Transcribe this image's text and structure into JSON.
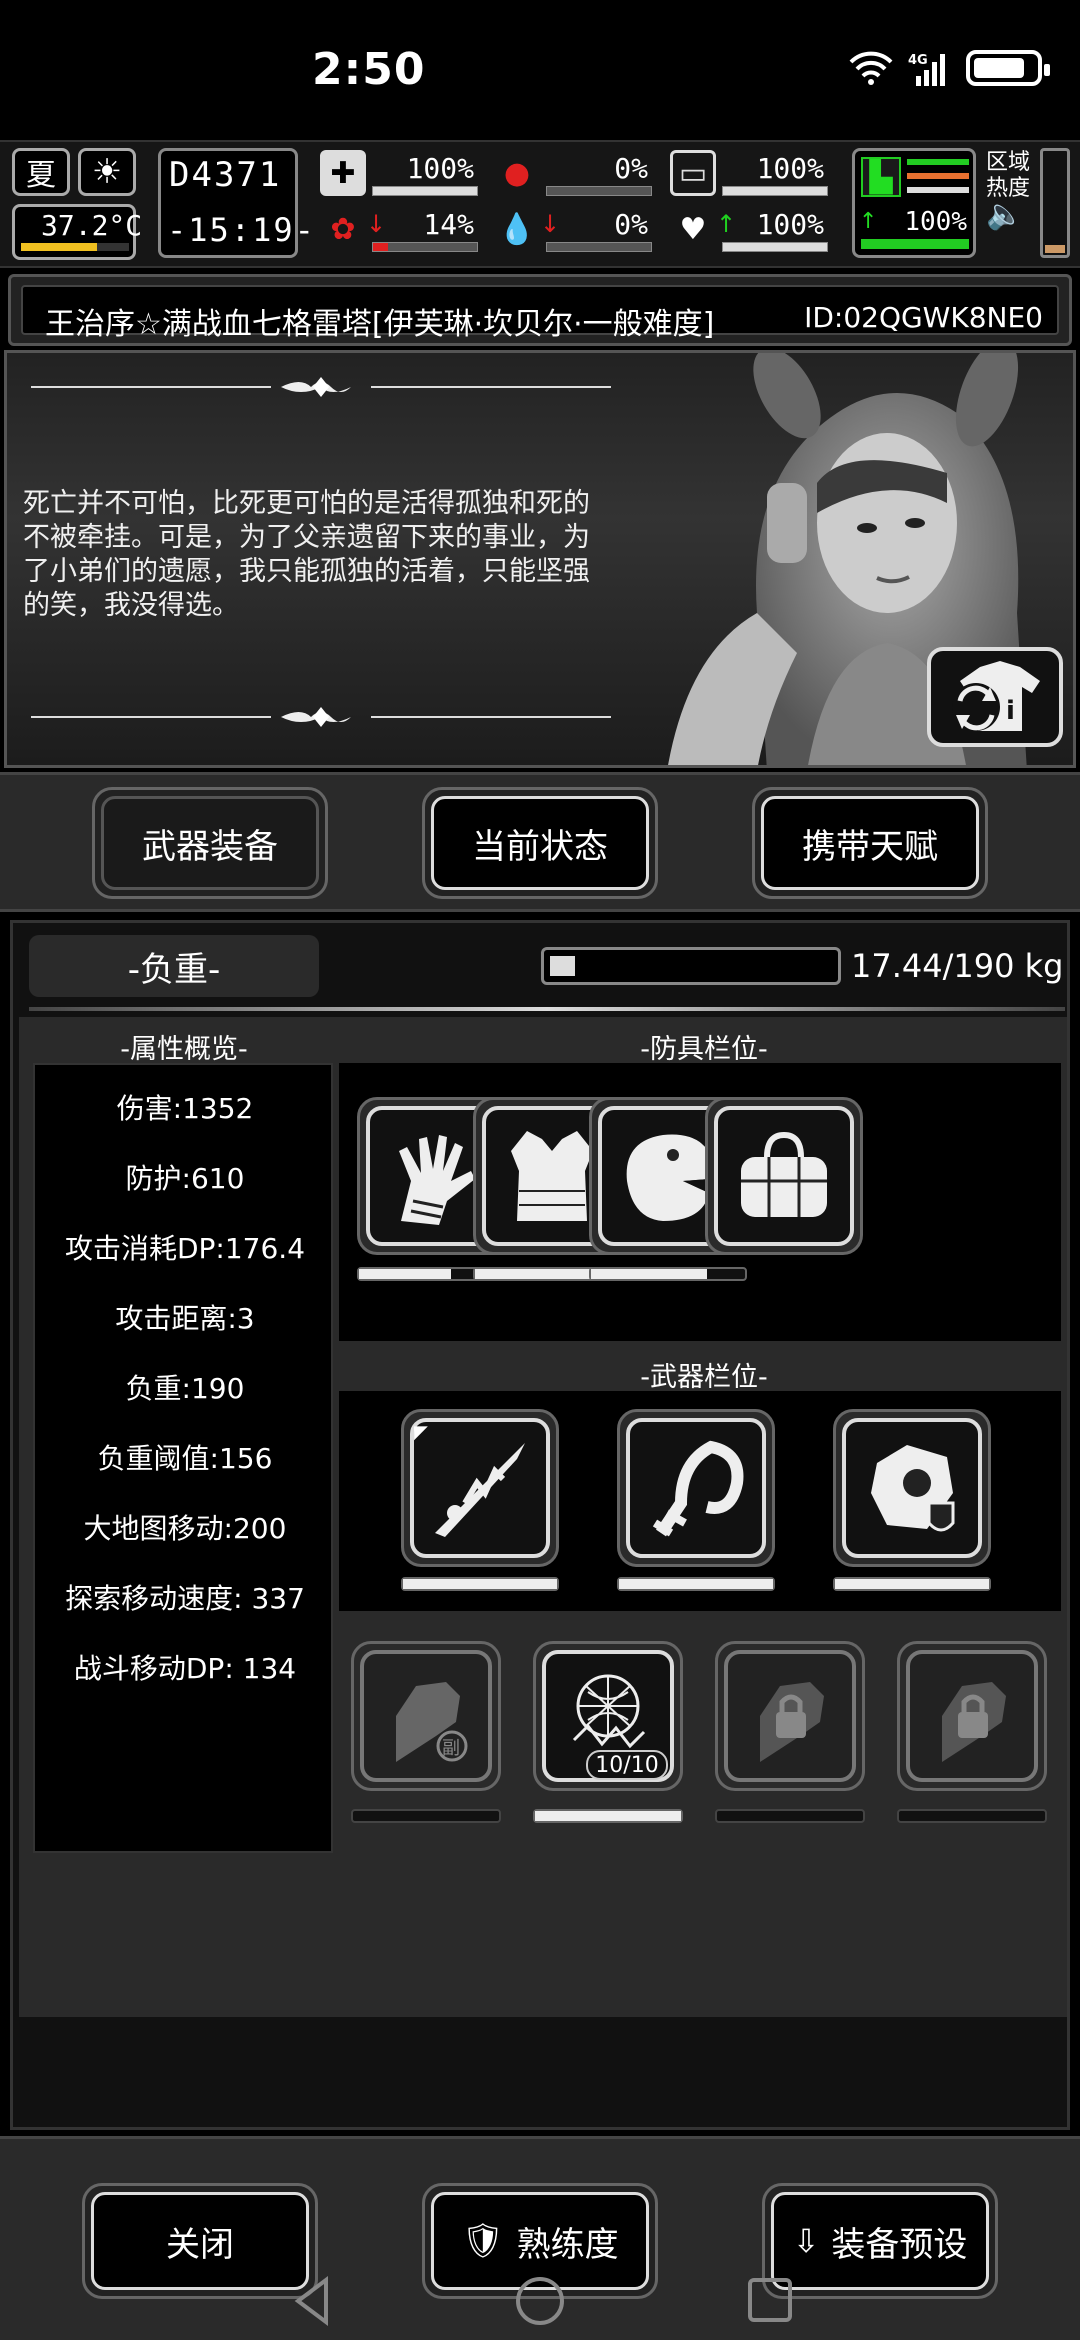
{
  "status_bar": {
    "time": "2:50",
    "network": "4G"
  },
  "hud": {
    "season": "夏",
    "temperature": "37.2°C",
    "day": "4371",
    "time": "-15:19-",
    "stats": [
      {
        "icon": "medkit-icon",
        "value": "100%",
        "level": 1.0
      },
      {
        "icon": "stomach-icon",
        "value": "0%",
        "level": 0.0
      },
      {
        "icon": "water-bottle-icon",
        "value": "100%",
        "level": 1.0
      },
      {
        "icon": "brain-icon",
        "value": "14%",
        "level": 0.14
      },
      {
        "icon": "blood-drop-icon",
        "value": "0%",
        "level": 0.0
      },
      {
        "icon": "heart-icon",
        "value": "100%",
        "level": 1.0
      }
    ],
    "stamina": "100%",
    "region_label": "区域热度"
  },
  "title": {
    "text": "王治序☆满战血七格雷塔[伊芙琳·坎贝尔·一般难度]",
    "id": "ID:02QGWK8NE0"
  },
  "character": {
    "quote": "死亡并不可怕，比死更可怕的是活得孤独和死的不被牵挂。可是，为了父亲遗留下来的事业，为了小弟们的遗愿，我只能孤独的活着，只能坚强的笑，我没得选。"
  },
  "tabs": [
    "武器装备",
    "当前状态",
    "携带天赋"
  ],
  "weight": {
    "label": "-负重-",
    "value": "17.44/190 kg",
    "fraction": 0.09
  },
  "attributes": {
    "header": "-属性概览-",
    "items": [
      "伤害:1352",
      "防护:610",
      "攻击消耗DP:176.4",
      "攻击距离:3",
      "负重:190",
      "负重阈值:156",
      "大地图移动:200",
      "探索移动速度: 337",
      "战斗移动DP: 134"
    ]
  },
  "armor": {
    "header": "-防具栏位-",
    "slots": [
      {
        "icon": "gloves-icon",
        "durability": 0.6
      },
      {
        "icon": "vest-icon",
        "durability": 1.0
      },
      {
        "icon": "dino-mask-icon",
        "durability": 0.75
      },
      {
        "icon": "duffel-bag-icon",
        "durability": null
      }
    ]
  },
  "weapons": {
    "header": "-武器栏位-",
    "slots": [
      {
        "icon": "spear-icon",
        "durability": 1.0
      },
      {
        "icon": "bone-whip-icon",
        "durability": 1.0
      },
      {
        "icon": "shield-armor-icon",
        "durability": 1.0
      }
    ]
  },
  "quick_slots": [
    {
      "icon": "offhand-fist-icon",
      "badge": "副"
    },
    {
      "icon": "net-trap-icon",
      "badge": "10/10"
    },
    {
      "icon": "locked-slot-icon"
    },
    {
      "icon": "locked-slot-icon"
    }
  ],
  "footer": {
    "close": "关闭",
    "proficiency": "熟练度",
    "preset": "装备预设"
  }
}
